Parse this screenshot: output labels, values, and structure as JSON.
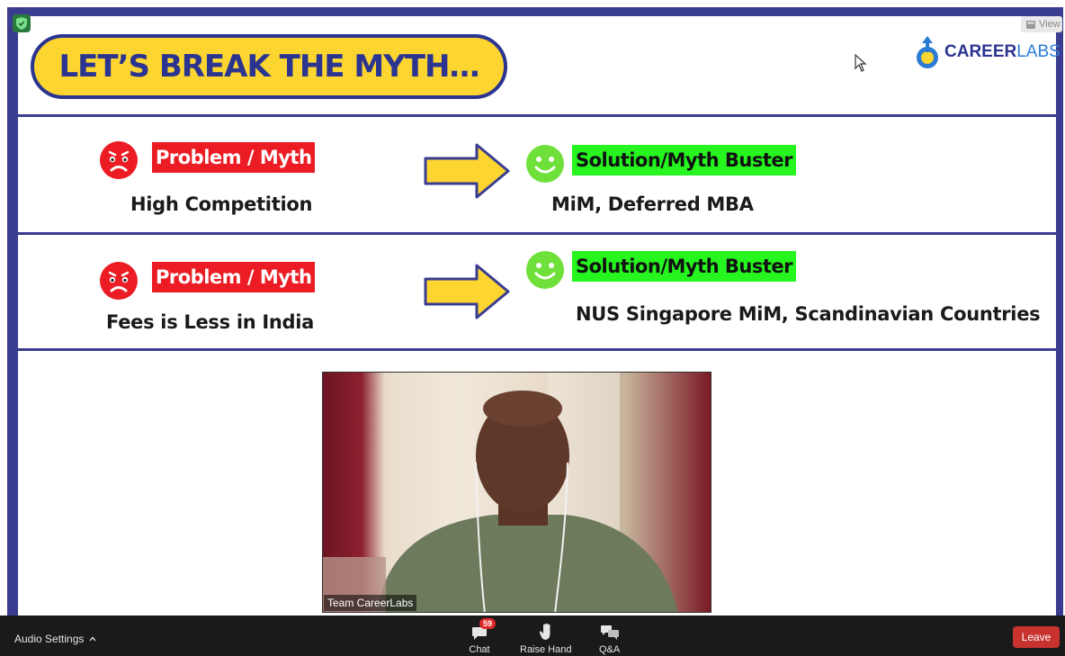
{
  "slide": {
    "title": "LET’S BREAK THE MYTH…",
    "logo": {
      "part1": "CAREER",
      "part2": "LABS"
    },
    "rows": [
      {
        "problem_tag": "Problem / Myth",
        "problem_text": "High Competition",
        "solution_tag": "Solution/Myth Buster",
        "solution_text": "MiM, Deferred MBA"
      },
      {
        "problem_tag": "Problem / Myth",
        "problem_text": "Fees is Less in India",
        "solution_tag": "Solution/Myth Buster",
        "solution_text": "NUS Singapore MiM, Scandinavian Countries"
      }
    ]
  },
  "top_right": {
    "view_label": "View"
  },
  "video": {
    "participant_name": "Team CareerLabs"
  },
  "toolbar": {
    "audio_settings": "Audio Settings",
    "chat_label": "Chat",
    "chat_badge": "59",
    "raise_hand_label": "Raise Hand",
    "qa_label": "Q&A",
    "leave_label": "Leave"
  },
  "colors": {
    "frame": "#3a3d8f",
    "title_fill": "#fcd531",
    "problem_tag": "#ec1c24",
    "solution_tag": "#26f51f",
    "leave": "#c8322f"
  },
  "icons": [
    "shield-icon",
    "sad-face-icon",
    "smile-face-icon",
    "right-arrow-icon",
    "chat-icon",
    "raise-hand-icon",
    "qa-icon",
    "chevron-up-icon",
    "mouse-cursor-icon"
  ]
}
